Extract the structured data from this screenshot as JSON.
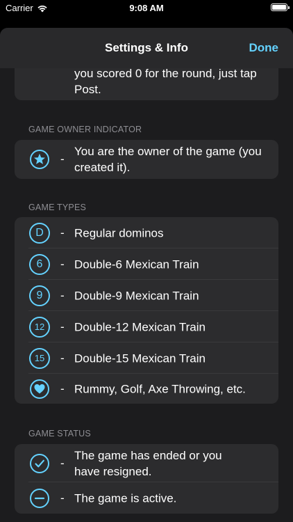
{
  "status_bar": {
    "carrier": "Carrier",
    "time": "9:08 AM"
  },
  "nav": {
    "title": "Settings & Info",
    "done_label": "Done"
  },
  "top_card": {
    "text": "you scored 0 for the round, just tap Post."
  },
  "owner_section": {
    "header": "GAME OWNER INDICATOR",
    "rows": [
      {
        "icon": "star-circle-icon",
        "dash": "-",
        "label": "You are the owner of the game (you created it)."
      }
    ]
  },
  "types_section": {
    "header": "GAME TYPES",
    "rows": [
      {
        "icon": "d-circle-icon",
        "glyph": "D",
        "dash": "-",
        "label": "Regular dominos"
      },
      {
        "icon": "six-circle-icon",
        "glyph": "6",
        "dash": "-",
        "label": "Double-6 Mexican Train"
      },
      {
        "icon": "nine-circle-icon",
        "glyph": "9",
        "dash": "-",
        "label": "Double-9 Mexican Train"
      },
      {
        "icon": "twelve-circle-icon",
        "glyph": "12",
        "dash": "-",
        "label": "Double-12 Mexican Train"
      },
      {
        "icon": "fifteen-circle-icon",
        "glyph": "15",
        "dash": "-",
        "label": "Double-15 Mexican Train"
      },
      {
        "icon": "heart-circle-icon",
        "dash": "-",
        "label": "Rummy, Golf, Axe Throwing, etc."
      }
    ]
  },
  "status_section": {
    "header": "GAME STATUS",
    "rows": [
      {
        "icon": "checkmark-circle-icon",
        "dash": "-",
        "label": "The game has ended or you have resigned."
      },
      {
        "icon": "minus-circle-icon",
        "dash": "-",
        "label": "The game is active."
      }
    ]
  },
  "colors": {
    "accent": "#64d2ff",
    "background": "#1c1c1e",
    "card": "#2c2c2e",
    "secondary_text": "#8e8e93"
  }
}
